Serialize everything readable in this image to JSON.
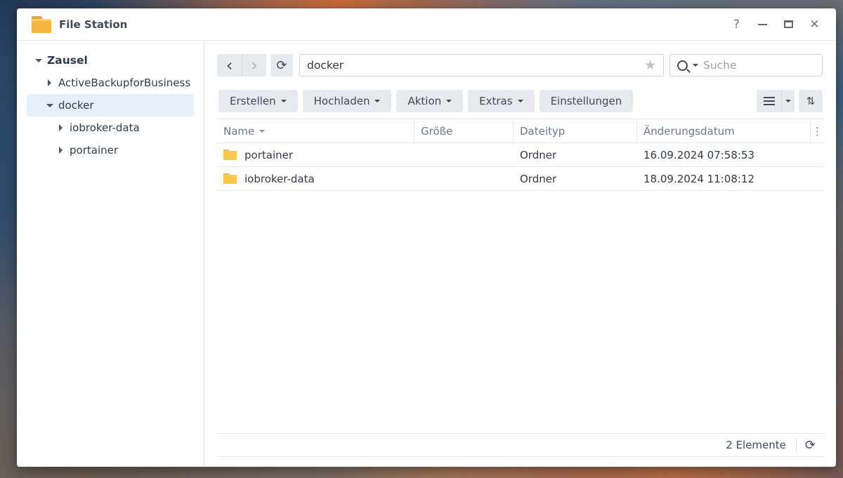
{
  "window": {
    "title": "File Station",
    "help_label": "?",
    "close_label": "✕"
  },
  "sidebar": {
    "root": "Zausel",
    "items": [
      {
        "label": "ActiveBackupforBusiness"
      },
      {
        "label": "docker"
      },
      {
        "label": "iobroker-data"
      },
      {
        "label": "portainer"
      }
    ]
  },
  "nav": {
    "back_label": "‹",
    "forward_label": "›",
    "refresh_label": "⟳",
    "path": "docker",
    "star_label": "★",
    "search_placeholder": "Suche"
  },
  "toolbar": {
    "create": "Erstellen",
    "upload": "Hochladen",
    "action": "Aktion",
    "extras": "Extras",
    "settings": "Einstellungen",
    "sort_label": "⇅"
  },
  "table": {
    "columns": {
      "name": "Name",
      "size": "Größe",
      "type": "Dateityp",
      "date": "Änderungsdatum",
      "more": "⋮"
    },
    "rows": [
      {
        "name": "portainer",
        "size": "",
        "type": "Ordner",
        "date": "16.09.2024 07:58:53"
      },
      {
        "name": "iobroker-data",
        "size": "",
        "type": "Ordner",
        "date": "18.09.2024 11:08:12"
      }
    ]
  },
  "footer": {
    "count": "2 Elemente",
    "refresh_label": "⟳"
  }
}
